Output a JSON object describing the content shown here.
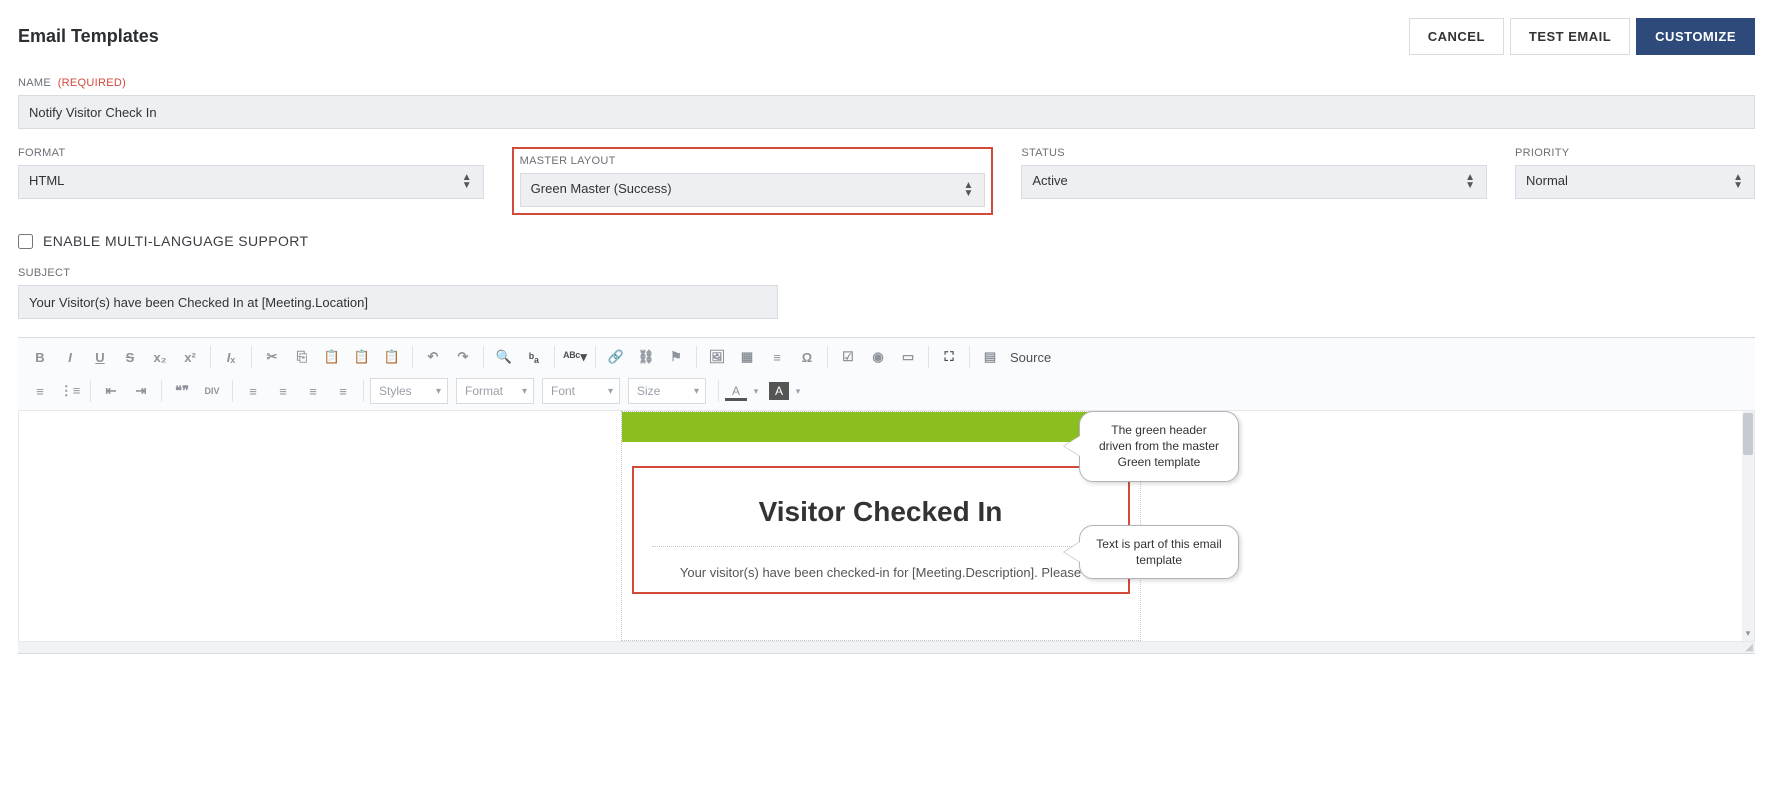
{
  "page_title": "Email Templates",
  "buttons": {
    "cancel": "CANCEL",
    "test_email": "TEST EMAIL",
    "customize": "CUSTOMIZE"
  },
  "fields": {
    "name": {
      "label": "NAME",
      "required_text": "(Required)",
      "value": "Notify Visitor Check In"
    },
    "format": {
      "label": "FORMAT",
      "value": "HTML"
    },
    "master_layout": {
      "label": "MASTER LAYOUT",
      "value": "Green Master (Success)"
    },
    "status": {
      "label": "STATUS",
      "value": "Active"
    },
    "priority": {
      "label": "PRIORITY",
      "value": "Normal"
    },
    "multi_lang": {
      "label": "ENABLE MULTI-LANGUAGE SUPPORT",
      "checked": false
    },
    "subject": {
      "label": "SUBJECT",
      "value": "Your Visitor(s) have been Checked In at [Meeting.Location]"
    }
  },
  "toolbar": {
    "source_label": "Source",
    "styles": "Styles",
    "format": "Format",
    "font": "Font",
    "size": "Size"
  },
  "email_preview": {
    "title": "Visitor Checked In",
    "body": "Your visitor(s) have been checked-in for [Meeting.Description]. Please"
  },
  "callouts": {
    "header_note": "The green header driven from the master Green template",
    "body_note": "Text is part of this email template"
  }
}
